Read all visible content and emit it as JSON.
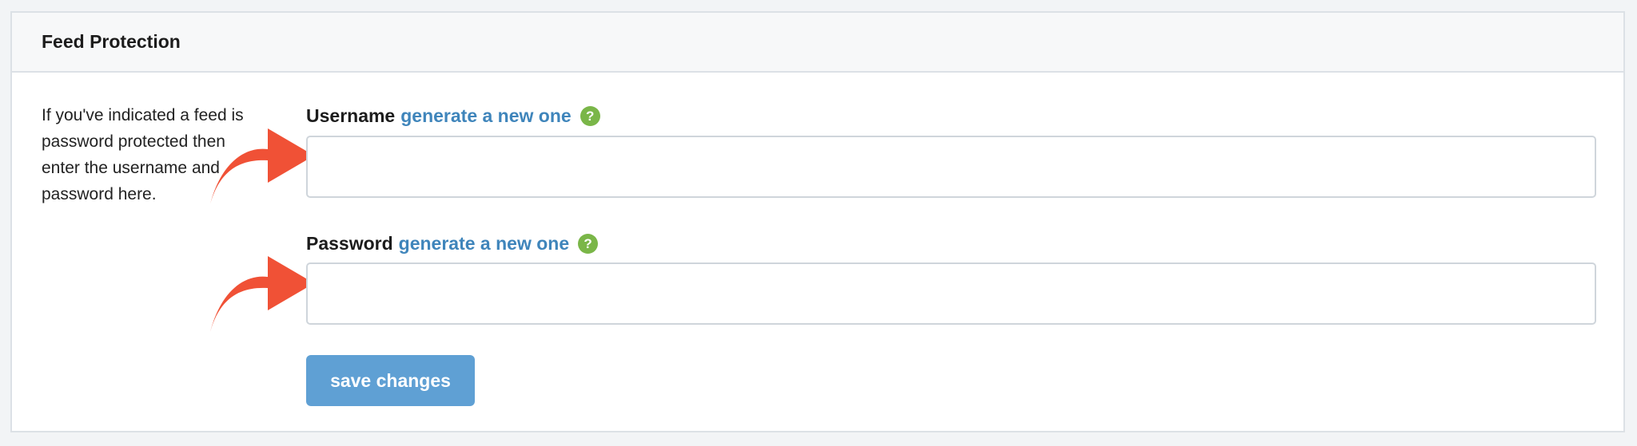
{
  "panel": {
    "title": "Feed Protection",
    "description": "If you've indicated a feed is password protected then enter the username and password here."
  },
  "fields": {
    "username": {
      "label": "Username",
      "link": "generate a new one",
      "help_icon": "?",
      "value": "",
      "placeholder": ""
    },
    "password": {
      "label": "Password",
      "link": "generate a new one",
      "help_icon": "?",
      "value": "",
      "placeholder": ""
    }
  },
  "actions": {
    "save_label": "save changes"
  },
  "colors": {
    "link": "#3f85bb",
    "help": "#7ab648",
    "button": "#5fa0d4",
    "arrow": "#f05136"
  },
  "icons": {
    "help": "question-circle-icon",
    "annotation_arrow": "curved-arrow-icon"
  }
}
